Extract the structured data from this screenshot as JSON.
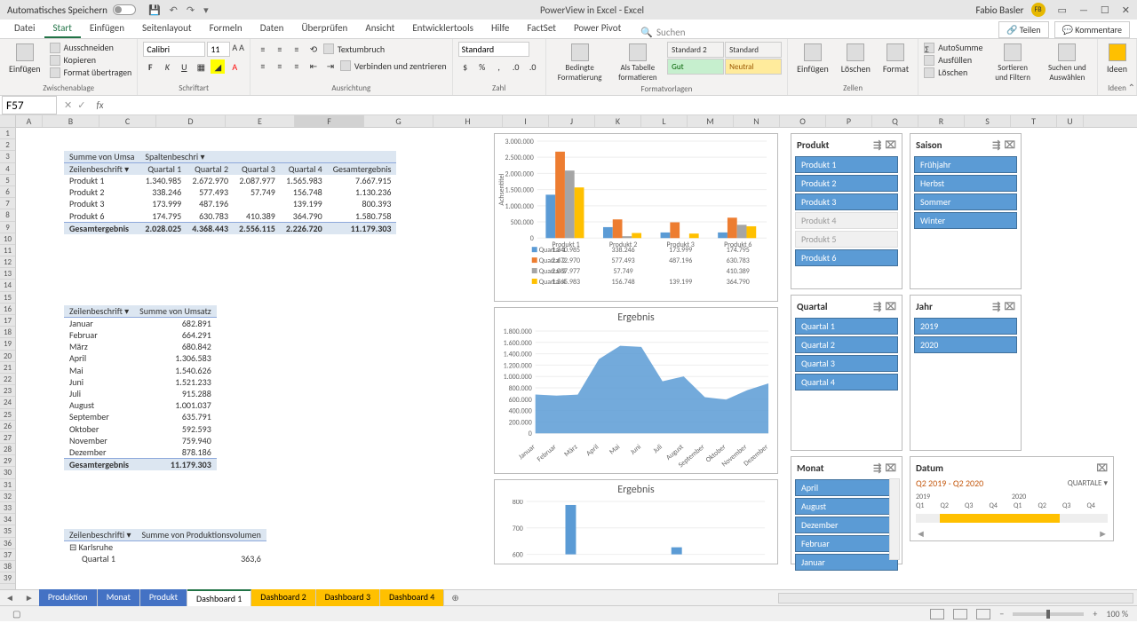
{
  "titlebar": {
    "autosave": "Automatisches Speichern",
    "title": "PowerView in Excel - Excel",
    "user": "Fabio Basler",
    "avatar": "FB"
  },
  "tabs": [
    "Datei",
    "Start",
    "Einfügen",
    "Seitenlayout",
    "Formeln",
    "Daten",
    "Überprüfen",
    "Ansicht",
    "Entwicklertools",
    "Hilfe",
    "FactSet",
    "Power Pivot"
  ],
  "search": "Suchen",
  "share": "Teilen",
  "comments": "Kommentare",
  "ribbon": {
    "clipboard": {
      "paste": "Einfügen",
      "cut": "Ausschneiden",
      "copy": "Kopieren",
      "format": "Format übertragen",
      "label": "Zwischenablage"
    },
    "font": {
      "name": "Calibri",
      "size": "11",
      "label": "Schriftart"
    },
    "align": {
      "wrap": "Textumbruch",
      "merge": "Verbinden und zentrieren",
      "label": "Ausrichtung"
    },
    "number": {
      "format": "Standard",
      "label": "Zahl"
    },
    "styles": {
      "cond": "Bedingte Formatierung",
      "table": "Als Tabelle formatieren",
      "s1": "Standard 2",
      "s2": "Standard",
      "s3": "Gut",
      "s4": "Neutral",
      "label": "Formatvorlagen"
    },
    "cells": {
      "insert": "Einfügen",
      "delete": "Löschen",
      "format": "Format",
      "label": "Zellen"
    },
    "editing": {
      "sum": "AutoSumme",
      "fill": "Ausfüllen",
      "clear": "Löschen",
      "sort": "Sortieren und Filtern",
      "find": "Suchen und Auswählen",
      "label": ""
    },
    "ideas": {
      "label": "Ideen",
      "btn": "Ideen"
    }
  },
  "namebox": "F57",
  "cols": [
    "A",
    "B",
    "C",
    "D",
    "E",
    "F",
    "G",
    "H",
    "I",
    "J",
    "K",
    "L",
    "M",
    "N",
    "O",
    "P",
    "Q",
    "R",
    "S",
    "T",
    "U"
  ],
  "pivot1": {
    "title": "Summe von Umsa",
    "colhdr": "Spaltenbeschri",
    "rowhdr": "Zeilenbeschrift",
    "cols": [
      "Quartal 1",
      "Quartal 2",
      "Quartal 3",
      "Quartal 4",
      "Gesamtergebnis"
    ],
    "rows": [
      {
        "label": "Produkt 1",
        "vals": [
          "1.340.985",
          "2.672.970",
          "2.087.977",
          "1.565.983",
          "7.667.915"
        ]
      },
      {
        "label": "Produkt 2",
        "vals": [
          "338.246",
          "577.493",
          "57.749",
          "156.748",
          "1.130.236"
        ]
      },
      {
        "label": "Produkt 3",
        "vals": [
          "173.999",
          "487.196",
          "",
          "139.199",
          "800.393"
        ]
      },
      {
        "label": "Produkt 6",
        "vals": [
          "174.795",
          "630.783",
          "410.389",
          "364.790",
          "1.580.758"
        ]
      }
    ],
    "total": {
      "label": "Gesamtergebnis",
      "vals": [
        "2.028.025",
        "4.368.443",
        "2.556.115",
        "2.226.720",
        "11.179.303"
      ]
    }
  },
  "pivot2": {
    "rowhdr": "Zeilenbeschrift",
    "valhdr": "Summe von Umsatz",
    "rows": [
      {
        "label": "Januar",
        "val": "682.891"
      },
      {
        "label": "Februar",
        "val": "664.291"
      },
      {
        "label": "März",
        "val": "680.842"
      },
      {
        "label": "April",
        "val": "1.306.583"
      },
      {
        "label": "Mai",
        "val": "1.540.626"
      },
      {
        "label": "Juni",
        "val": "1.521.233"
      },
      {
        "label": "Juli",
        "val": "915.288"
      },
      {
        "label": "August",
        "val": "1.001.037"
      },
      {
        "label": "September",
        "val": "635.791"
      },
      {
        "label": "Oktober",
        "val": "592.593"
      },
      {
        "label": "November",
        "val": "759.940"
      },
      {
        "label": "Dezember",
        "val": "878.186"
      }
    ],
    "total": {
      "label": "Gesamtergebnis",
      "val": "11.179.303"
    }
  },
  "pivot3": {
    "rowhdr": "Zeilenbeschrifti",
    "valhdr": "Summe von Produktionsvolumen",
    "row1": {
      "label": "Karlsruhe"
    },
    "row2": {
      "label": "Quartal 1",
      "val": "363,6"
    }
  },
  "chart_data": [
    {
      "type": "bar",
      "title": "",
      "categories": [
        "Produkt 1",
        "Produkt 2",
        "Produkt 3",
        "Produkt 6"
      ],
      "series": [
        {
          "name": "Quartal 1",
          "values": [
            1340985,
            338246,
            173999,
            174795
          ],
          "color": "#5b9bd5"
        },
        {
          "name": "Quartal 2",
          "values": [
            2672970,
            577493,
            487196,
            630783
          ],
          "color": "#ed7d31"
        },
        {
          "name": "Quartal 3",
          "values": [
            2087977,
            57749,
            0,
            410389
          ],
          "color": "#a5a5a5"
        },
        {
          "name": "Quartal 4",
          "values": [
            1565983,
            156748,
            139199,
            364790
          ],
          "color": "#ffc000"
        }
      ],
      "ylabel": "Achsentitel",
      "ylim": [
        0,
        3000000
      ],
      "yticks": [
        "0",
        "500.000",
        "1.000.000",
        "1.500.000",
        "2.000.000",
        "2.500.000",
        "3.000.000"
      ],
      "table": [
        [
          "",
          "Produkt 1",
          "Produkt 2",
          "Produkt 3",
          "Produkt 6"
        ],
        [
          "Quartal 1",
          "1.340.985",
          "338.246",
          "173.999",
          "174.795"
        ],
        [
          "Quartal 2",
          "2.672.970",
          "577.493",
          "487.196",
          "630.783"
        ],
        [
          "Quartal 3",
          "2.087.977",
          "57.749",
          "",
          "410.389"
        ],
        [
          "Quartal 4",
          "1.565.983",
          "156.748",
          "139.199",
          "364.790"
        ]
      ]
    },
    {
      "type": "area",
      "title": "Ergebnis",
      "categories": [
        "Januar",
        "Februar",
        "März",
        "April",
        "Mai",
        "Juni",
        "Juli",
        "August",
        "September",
        "Oktober",
        "November",
        "Dezember"
      ],
      "values": [
        682891,
        664291,
        680842,
        1306583,
        1540626,
        1521233,
        915288,
        1001037,
        635791,
        592593,
        759940,
        878186
      ],
      "ylim": [
        0,
        1800000
      ],
      "yticks": [
        "0",
        "200.000",
        "400.000",
        "600.000",
        "800.000",
        "1.000.000",
        "1.200.000",
        "1.400.000",
        "1.600.000",
        "1.800.000"
      ],
      "color": "#5b9bd5"
    },
    {
      "type": "bar",
      "title": "Ergebnis",
      "yticks": [
        "600",
        "700",
        "800"
      ],
      "ylim": [
        550,
        850
      ]
    }
  ],
  "slicers": {
    "produkt": {
      "title": "Produkt",
      "items": [
        {
          "label": "Produkt 1",
          "on": true
        },
        {
          "label": "Produkt 2",
          "on": true
        },
        {
          "label": "Produkt 3",
          "on": true
        },
        {
          "label": "Produkt 4",
          "on": false
        },
        {
          "label": "Produkt 5",
          "on": false
        },
        {
          "label": "Produkt 6",
          "on": true
        }
      ]
    },
    "saison": {
      "title": "Saison",
      "items": [
        {
          "label": "Frühjahr",
          "on": true
        },
        {
          "label": "Herbst",
          "on": true
        },
        {
          "label": "Sommer",
          "on": true
        },
        {
          "label": "Winter",
          "on": true
        }
      ]
    },
    "quartal": {
      "title": "Quartal",
      "items": [
        {
          "label": "Quartal 1",
          "on": true
        },
        {
          "label": "Quartal 2",
          "on": true
        },
        {
          "label": "Quartal 3",
          "on": true
        },
        {
          "label": "Quartal 4",
          "on": true
        }
      ]
    },
    "jahr": {
      "title": "Jahr",
      "items": [
        {
          "label": "2019",
          "on": true
        },
        {
          "label": "2020",
          "on": true
        }
      ]
    },
    "monat": {
      "title": "Monat",
      "items": [
        {
          "label": "April",
          "on": true
        },
        {
          "label": "August",
          "on": true
        },
        {
          "label": "Dezember",
          "on": true
        },
        {
          "label": "Februar",
          "on": true
        },
        {
          "label": "Januar",
          "on": true
        }
      ]
    }
  },
  "timeline": {
    "title": "Datum",
    "range": "Q2 2019 - Q2 2020",
    "unit": "QUARTALE",
    "years": [
      "2019",
      "2020"
    ],
    "ticks": [
      "Q1",
      "Q2",
      "Q3",
      "Q4",
      "Q1",
      "Q2",
      "Q3",
      "Q4"
    ]
  },
  "sheets": [
    {
      "name": "Produktion",
      "color": "blue"
    },
    {
      "name": "Monat",
      "color": "blue"
    },
    {
      "name": "Produkt",
      "color": "blue"
    },
    {
      "name": "Dashboard 1",
      "color": "yellow",
      "active": true
    },
    {
      "name": "Dashboard 2",
      "color": "yellow"
    },
    {
      "name": "Dashboard 3",
      "color": "yellow"
    },
    {
      "name": "Dashboard 4",
      "color": "yellow"
    }
  ],
  "zoom": "100 %"
}
